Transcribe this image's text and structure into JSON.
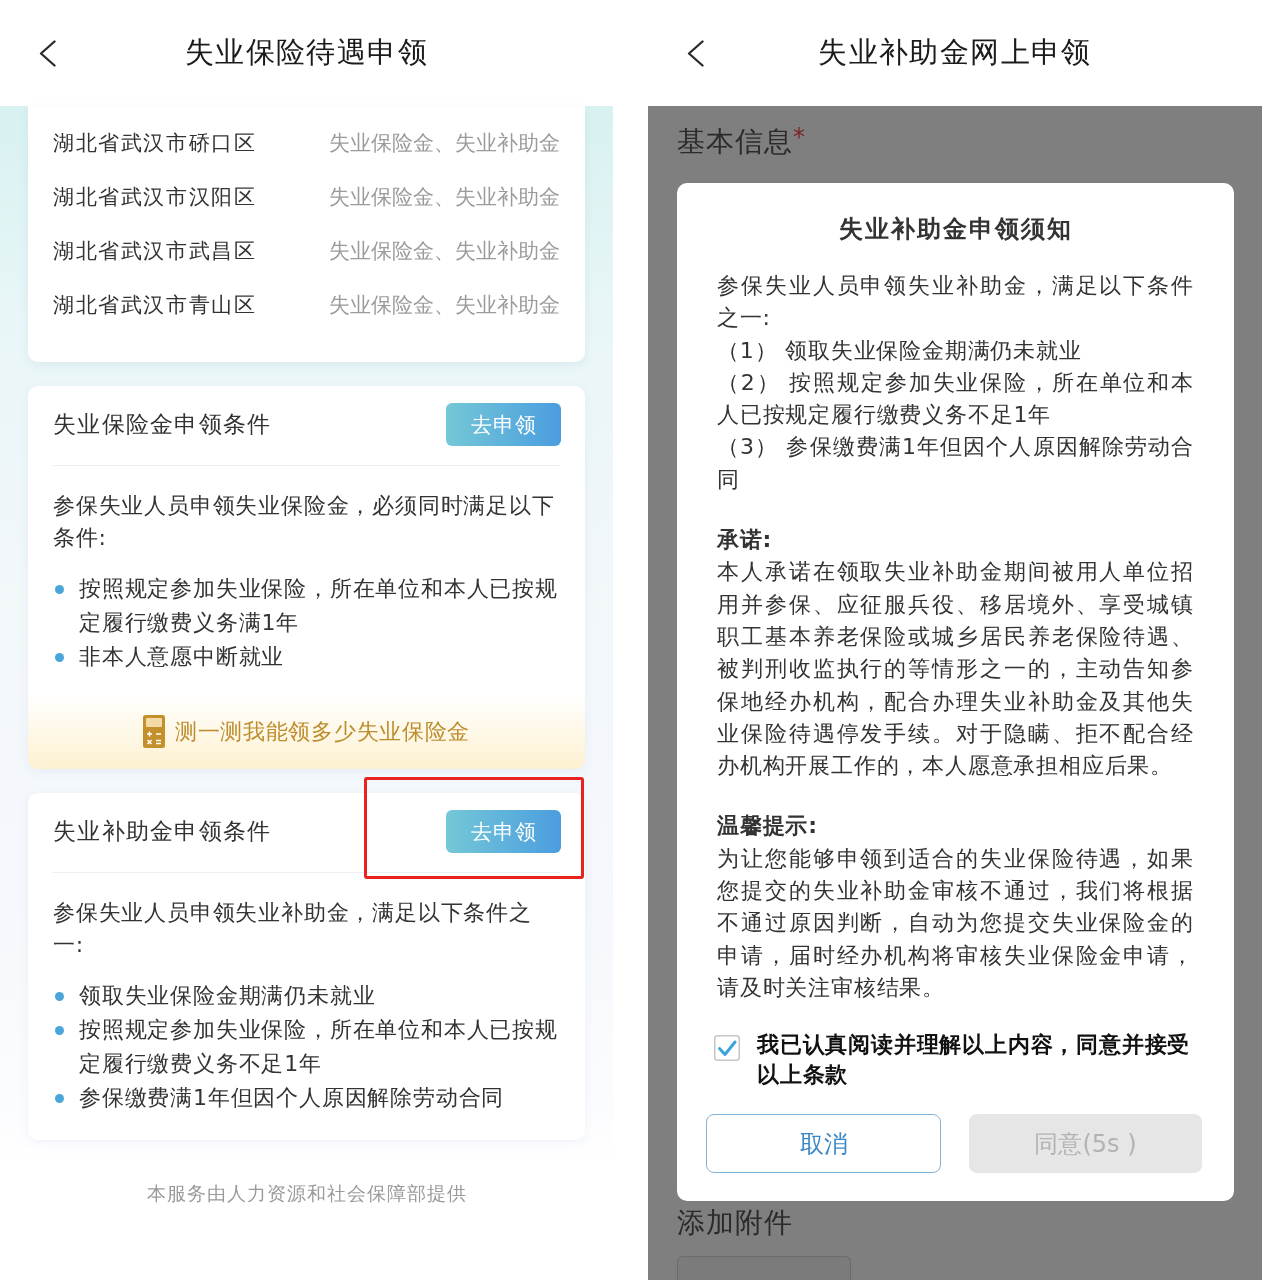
{
  "left_screen": {
    "header": {
      "title": "失业保险待遇申领"
    },
    "regions": [
      {
        "name": "湖北省武汉市硚口区",
        "benefits": "失业保险金、失业补助金"
      },
      {
        "name": "湖北省武汉市汉阳区",
        "benefits": "失业保险金、失业补助金"
      },
      {
        "name": "湖北省武汉市武昌区",
        "benefits": "失业保险金、失业补助金"
      },
      {
        "name": "湖北省武汉市青山区",
        "benefits": "失业保险金、失业补助金"
      }
    ],
    "sections": [
      {
        "title": "失业保险金申领条件",
        "button": "去申领",
        "highlighted": false,
        "intro": "参保失业人员申领失业保险金，必须同时满足以下条件:",
        "conditions": [
          "按照规定参加失业保险，所在单位和本人已按规定履行缴费义务满1年",
          "非本人意愿中断就业"
        ],
        "calculator_link": "测一测我能领多少失业保险金"
      },
      {
        "title": "失业补助金申领条件",
        "button": "去申领",
        "highlighted": true,
        "intro": "参保失业人员申领失业补助金，满足以下条件之一:",
        "conditions": [
          "领取失业保险金期满仍未就业",
          "按照规定参加失业保险，所在单位和本人已按规定履行缴费义务不足1年",
          "参保缴费满1年但因个人原因解除劳动合同"
        ]
      }
    ],
    "footer": "本服务由人力资源和社会保障部提供"
  },
  "right_screen": {
    "header": {
      "title": "失业补助金网上申领"
    },
    "form": {
      "section_title": "基本信息",
      "required_mark": "*",
      "attachment_title": "添加附件"
    },
    "dialog": {
      "title": "失业补助金申领须知",
      "intro": "参保失业人员申领失业补助金，满足以下条件之一:",
      "conditions": [
        "（1） 领取失业保险金期满仍未就业",
        "（2） 按照规定参加失业保险，所在单位和本人已按规定履行缴费义务不足1年",
        "（3） 参保缴费满1年但因个人原因解除劳动合同"
      ],
      "notes": [
        {
          "heading": "承诺:",
          "text": "本人承诺在领取失业补助金期间被用人单位招用并参保、应征服兵役、移居境外、享受城镇职工基本养老保险或城乡居民养老保险待遇、被判刑收监执行的等情形之一的，主动告知参保地经办机构，配合办理失业补助金及其他失业保险待遇停发手续。对于隐瞒、拒不配合经办机构开展工作的，本人愿意承担相应后果。"
        },
        {
          "heading": "温馨提示:",
          "text": "为让您能够申领到适合的失业保险待遇，如果您提交的失业补助金审核不通过，我们将根据不通过原因判断，自动为您提交失业保险金的申请，届时经办机构将审核失业保险金申请，请及时关注审核结果。"
        }
      ],
      "agreement": {
        "label": "我已认真阅读并理解以上内容，同意并接受以上条款",
        "checked": true
      },
      "buttons": [
        {
          "label": "取消",
          "disabled": false
        },
        {
          "label": "同意(5s )",
          "disabled": true
        }
      ]
    }
  }
}
